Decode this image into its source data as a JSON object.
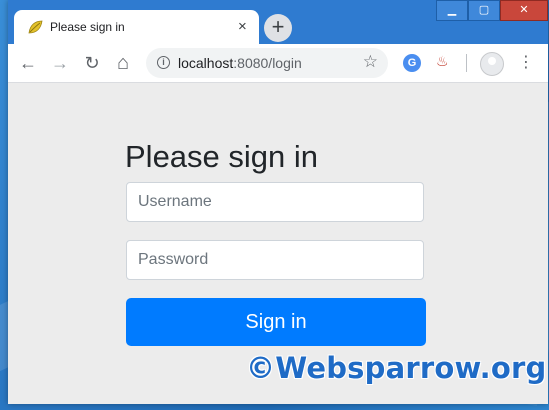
{
  "tab": {
    "title": "Please sign in",
    "close": "×",
    "new_tab": "+"
  },
  "window_controls": {
    "minimize": "▁",
    "maximize": "▢",
    "close": "✕"
  },
  "nav": {
    "back": "←",
    "forward": "→",
    "reload": "↻",
    "home": "⌂"
  },
  "address_bar": {
    "host": "localhost",
    "rest": ":8080/login",
    "info": "i",
    "star": "☆"
  },
  "extensions": {
    "grammarly": "G",
    "java": "♨",
    "menu": "⋮"
  },
  "form": {
    "heading": "Please sign in",
    "username_placeholder": "Username",
    "password_placeholder": "Password",
    "submit_label": "Sign in"
  },
  "watermark": "©Websparrow.org",
  "colors": {
    "primary": "#007bff",
    "window_frame": "#2f7bd0",
    "page_bg": "#ececec"
  },
  "icons": [
    "spring-leaf-icon",
    "close-icon",
    "plus-icon",
    "back-icon",
    "forward-icon",
    "reload-icon",
    "home-icon",
    "info-icon",
    "star-icon",
    "grammarly-icon",
    "java-icon",
    "profile-icon",
    "more-icon"
  ]
}
